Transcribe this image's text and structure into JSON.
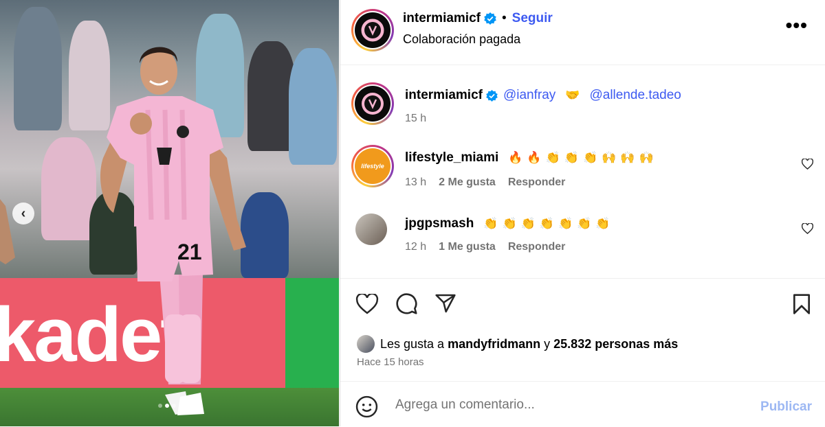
{
  "post": {
    "author": "intermiamicf",
    "follow_label": "Seguir",
    "separator": "•",
    "subtitle": "Colaboración pagada",
    "more_label": "•••"
  },
  "caption": {
    "user": "intermiamicf",
    "mention_1": "@ianfray",
    "handshake": "🤝",
    "mention_2": "@allende.tadeo",
    "time": "15 h"
  },
  "comments": [
    {
      "user": "lifestyle_miami",
      "avatar_label": "lifestyle",
      "emojis": [
        "🔥",
        "🔥",
        "👏",
        "👏",
        "👏",
        "🙌",
        "🙌",
        "🙌"
      ],
      "time": "13 h",
      "likes": "2 Me gusta",
      "reply": "Responder"
    },
    {
      "user": "jpgpsmash",
      "emojis": [
        "👏",
        "👏",
        "👏",
        "👏",
        "👏",
        "👏",
        "👏"
      ],
      "time": "12 h",
      "likes": "1 Me gusta",
      "reply": "Responder"
    }
  ],
  "likes": {
    "prefix": "Les gusta a",
    "user": "mandyfridmann",
    "connector": "y",
    "rest": "25.832 personas más",
    "time": "Hace 15 horas"
  },
  "composer": {
    "placeholder": "Agrega un comentario...",
    "publish": "Publicar"
  },
  "media": {
    "ad_text": "kadet",
    "jersey_number": "21",
    "carousel_dots": 3,
    "active_dot": 2
  },
  "colors": {
    "link": "#3d5af1",
    "muted": "#737373",
    "publish_disabled": "#9db8f3",
    "jersey_pink": "#f4b6d4"
  }
}
